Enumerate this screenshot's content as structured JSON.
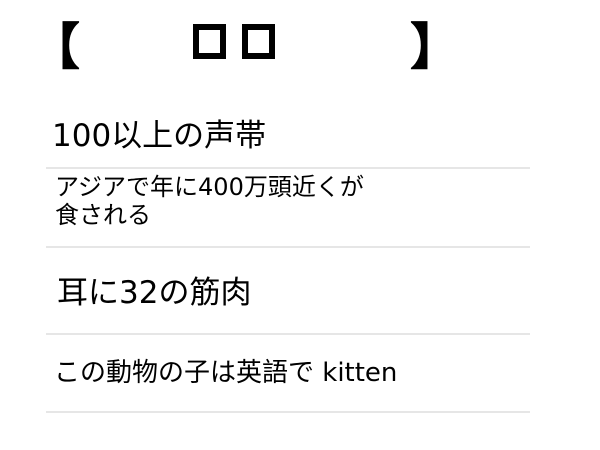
{
  "header": {
    "bracket_open": "【",
    "bracket_close": "】",
    "answer_slots": [
      "",
      ""
    ]
  },
  "hints": [
    "100以上の声帯",
    "アジアで年に400万頭近くが\n食される",
    "耳に32の筋肉",
    "この動物の子は英語で kitten"
  ]
}
